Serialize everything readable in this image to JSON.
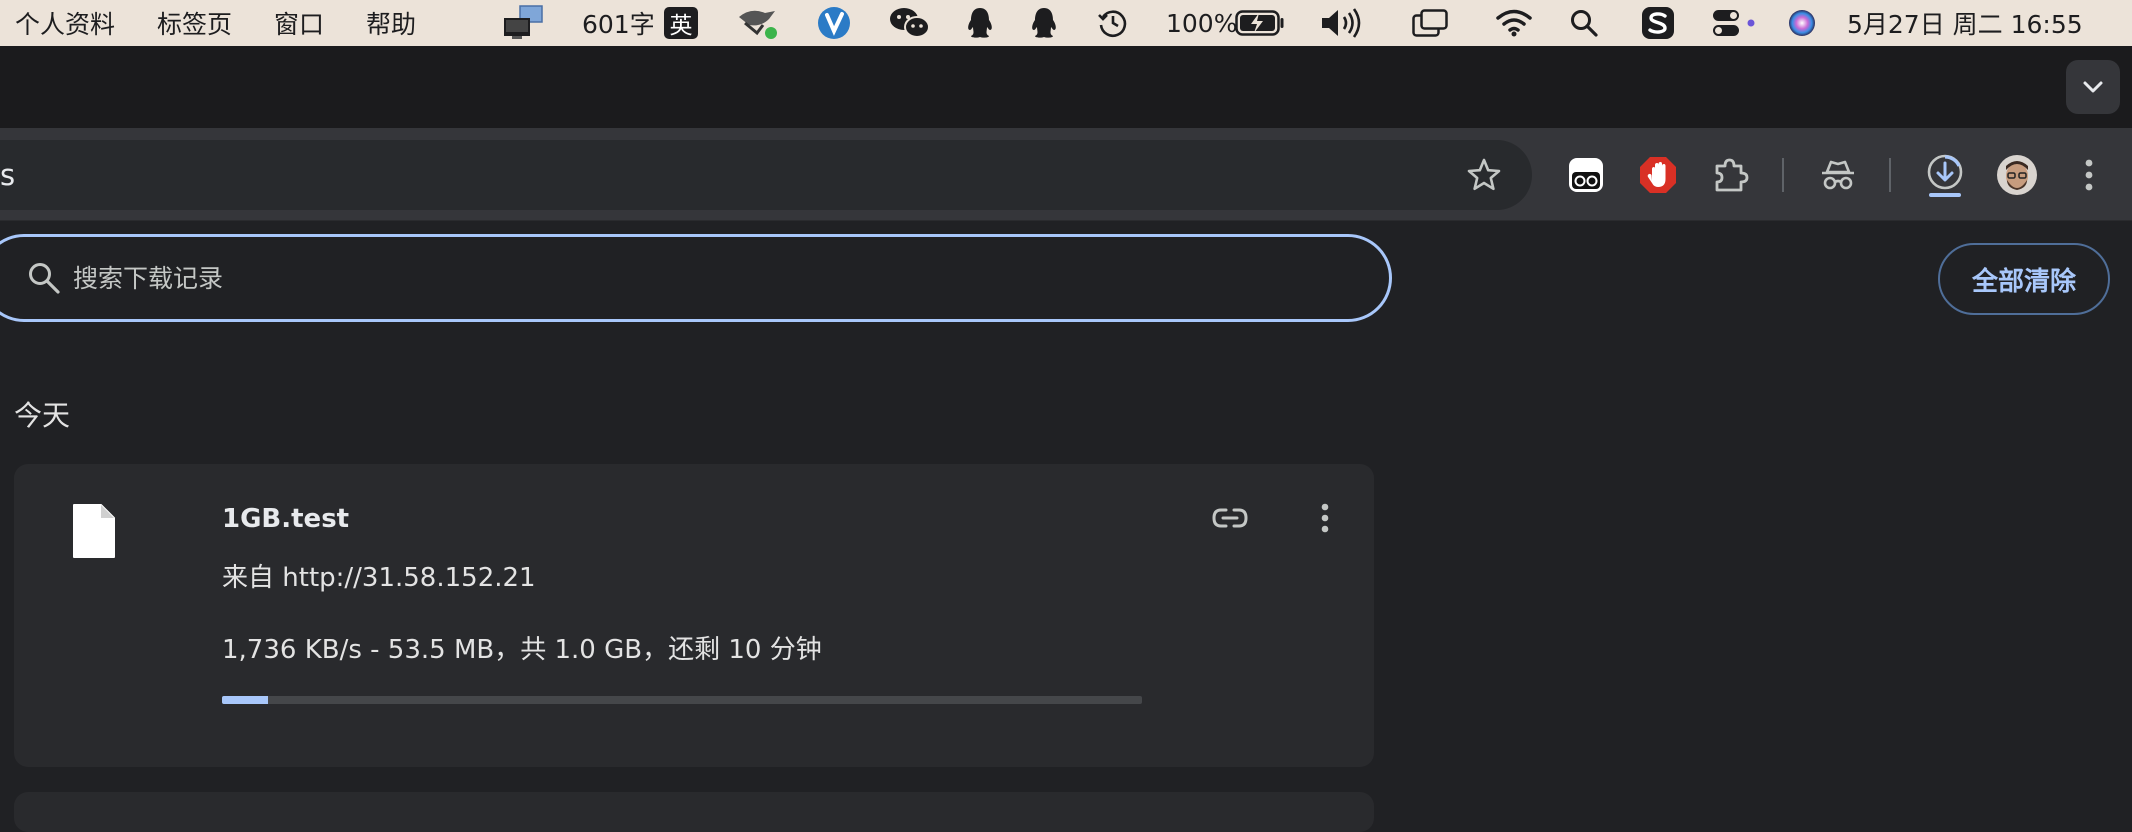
{
  "menubar": {
    "items": [
      "个人资料",
      "标签页",
      "窗口",
      "帮助"
    ],
    "word_count": "601字",
    "ime_label": "英",
    "battery": "100%",
    "datetime": "5月27日 周二  16:55"
  },
  "toolbar": {
    "omnibox_text": "s"
  },
  "downloads": {
    "search_placeholder": "搜索下载记录",
    "clear_all_label": "全部清除",
    "section_today": "今天",
    "items": [
      {
        "name": "1GB.test",
        "source": "来自 http://31.58.152.21",
        "status": "1,736 KB/s - 53.5 MB，共 1.0 GB，还剩 10 分钟",
        "progress": 0.05
      }
    ]
  },
  "colors": {
    "accent": "#a8c7fa",
    "background": "#202124",
    "card": "#292a2d",
    "toolbar": "#35363a"
  },
  "icons": {
    "menubar": [
      "display-icon",
      "ime-icon",
      "dragon-icon",
      "v-icon",
      "wechat-icon",
      "qq-icon",
      "qq-icon",
      "time-machine-icon",
      "battery-icon",
      "volume-icon",
      "screen-mirror-icon",
      "wifi-icon",
      "spotlight-icon",
      "sogou-icon",
      "control-center-icon",
      "siri-icon"
    ],
    "toolbar": [
      "star-icon",
      "eyes-extension-icon",
      "adblock-icon",
      "puzzle-icon",
      "incognito-icon",
      "download-icon",
      "avatar",
      "more-vert-icon"
    ]
  }
}
